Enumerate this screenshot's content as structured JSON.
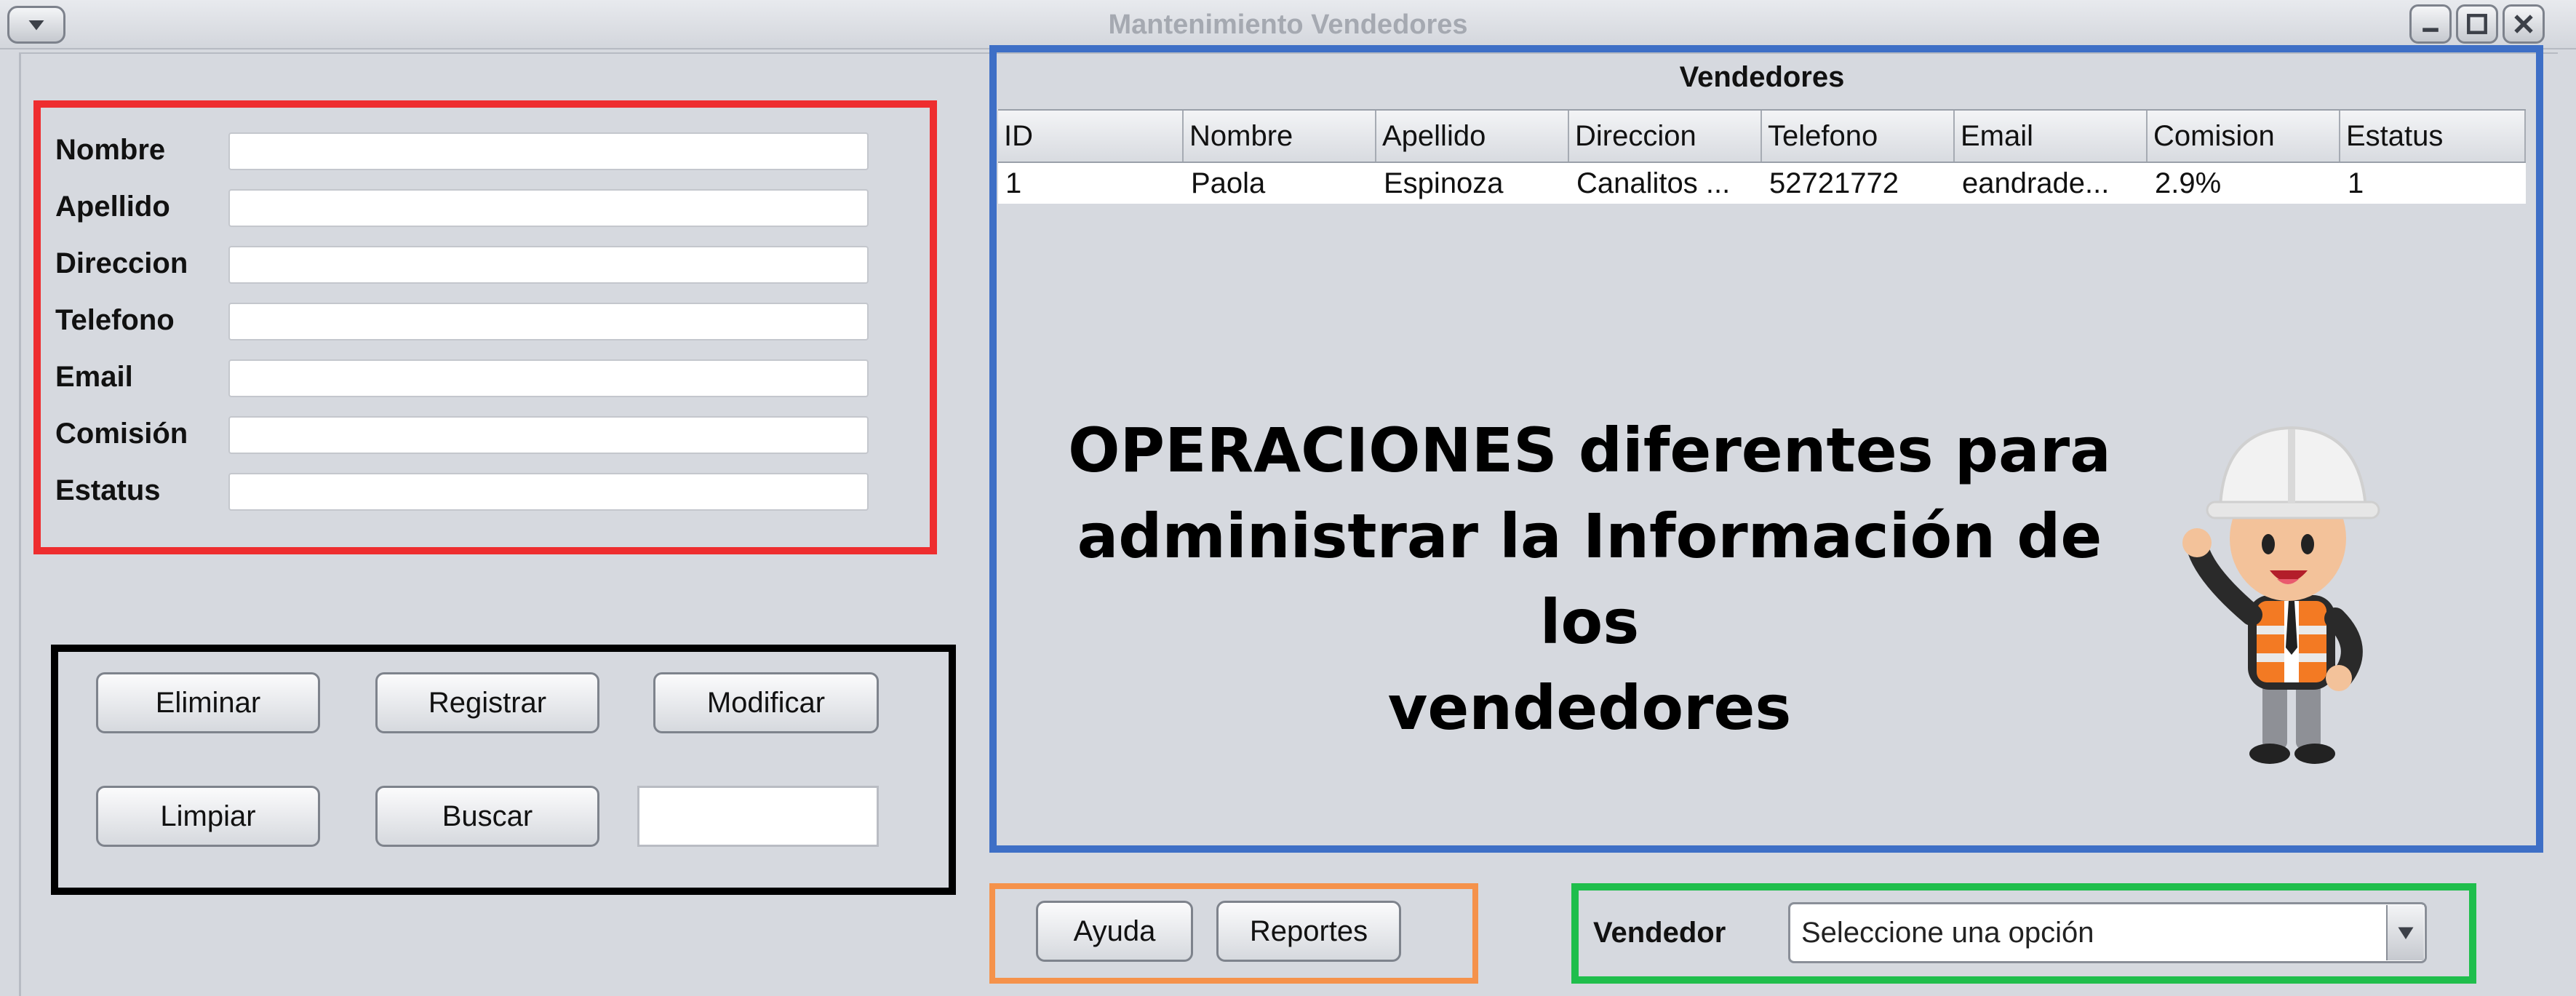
{
  "window": {
    "title": "Mantenimiento Vendedores"
  },
  "form": {
    "fields": [
      {
        "label": "Nombre",
        "value": ""
      },
      {
        "label": "Apellido",
        "value": ""
      },
      {
        "label": "Direccion",
        "value": ""
      },
      {
        "label": "Telefono",
        "value": ""
      },
      {
        "label": "Email",
        "value": ""
      },
      {
        "label": "Comisión",
        "value": ""
      },
      {
        "label": "Estatus",
        "value": ""
      }
    ]
  },
  "actions": {
    "eliminar": "Eliminar",
    "registrar": "Registrar",
    "modificar": "Modificar",
    "limpiar": "Limpiar",
    "buscar": "Buscar",
    "search_value": ""
  },
  "table": {
    "title": "Vendedores",
    "columns": [
      "ID",
      "Nombre",
      "Apellido",
      "Direccion",
      "Telefono",
      "Email",
      "Comision",
      "Estatus"
    ],
    "rows": [
      [
        "1",
        "Paola",
        "Espinoza",
        "Canalitos ...",
        "52721772",
        "eandrade...",
        "2.9%",
        "1"
      ]
    ]
  },
  "overlay": {
    "line1": "OPERACIONES diferentes para",
    "line2": "administrar la Información de los",
    "line3": "vendedores"
  },
  "footer": {
    "ayuda": "Ayuda",
    "reportes": "Reportes",
    "vendedor_label": "Vendedor",
    "vendedor_selected": "Seleccione una opción"
  },
  "annotation_colors": {
    "form_box": "#ee2d2f",
    "actions_box": "#000000",
    "table_box": "#3e6fc6",
    "footer_buttons_box": "#f5924b",
    "vendedor_box": "#1fbe4c"
  },
  "icons": {
    "system_menu": "chevron-down-icon",
    "minimize": "minimize-icon",
    "maximize": "maximize-icon",
    "close": "close-icon",
    "combo": "chevron-down-icon",
    "illustration": "worker-cartoon"
  }
}
